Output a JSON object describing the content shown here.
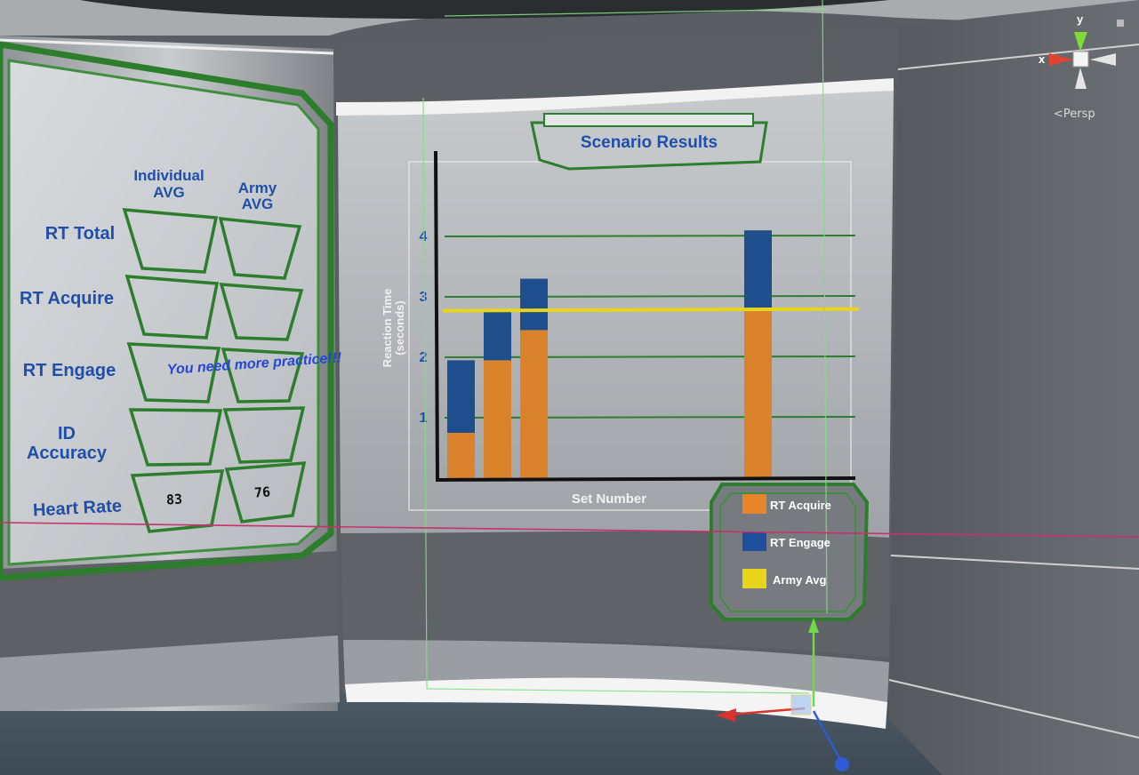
{
  "scene": {
    "view_mode": "Persp",
    "gizmo": {
      "axis_y": "y",
      "axis_x": "x"
    }
  },
  "stats_panel": {
    "col_headers": [
      "Individual\nAVG",
      "Army\nAVG"
    ],
    "col_header_lines": [
      [
        "Individual",
        "AVG"
      ],
      [
        "Army",
        "AVG"
      ]
    ],
    "rows": [
      {
        "label": "RT Total",
        "individual": "",
        "army": ""
      },
      {
        "label": "RT Acquire",
        "individual": "",
        "army": ""
      },
      {
        "label": "RT Engage",
        "individual": "",
        "army": ""
      },
      {
        "label_lines": [
          "ID",
          "Accuracy"
        ],
        "label": "ID Accuracy",
        "individual": "",
        "army": ""
      },
      {
        "label": "Heart Rate",
        "individual": "83",
        "army": "76"
      }
    ],
    "message": "You need more practice!!!"
  },
  "chart_panel": {
    "title": "Scenario Results",
    "colors": {
      "acquire": "#d9822b",
      "engage": "#1f4e8c",
      "army_avg": "#e6d51a",
      "grid": "#2f7d2f"
    }
  },
  "chart_data": {
    "type": "bar",
    "stacked": true,
    "title": "Scenario Results",
    "xlabel": "Set Number",
    "ylabel": "Reaction Time (seconds)",
    "ylim": [
      0,
      4
    ],
    "yticks": [
      1,
      2,
      3,
      4
    ],
    "categories": [
      "",
      "",
      "",
      ""
    ],
    "series": [
      {
        "name": "RT Acquire",
        "values": [
          0.75,
          1.95,
          2.45,
          2.8
        ]
      },
      {
        "name": "RT Engage",
        "values": [
          1.2,
          0.8,
          0.85,
          1.3
        ]
      }
    ],
    "reference_lines": [
      {
        "name": "Army Avg",
        "value": 2.8
      }
    ],
    "legend": [
      "RT Acquire",
      "RT Engage",
      "Army Avg"
    ],
    "legend_position": "bottom-right"
  }
}
